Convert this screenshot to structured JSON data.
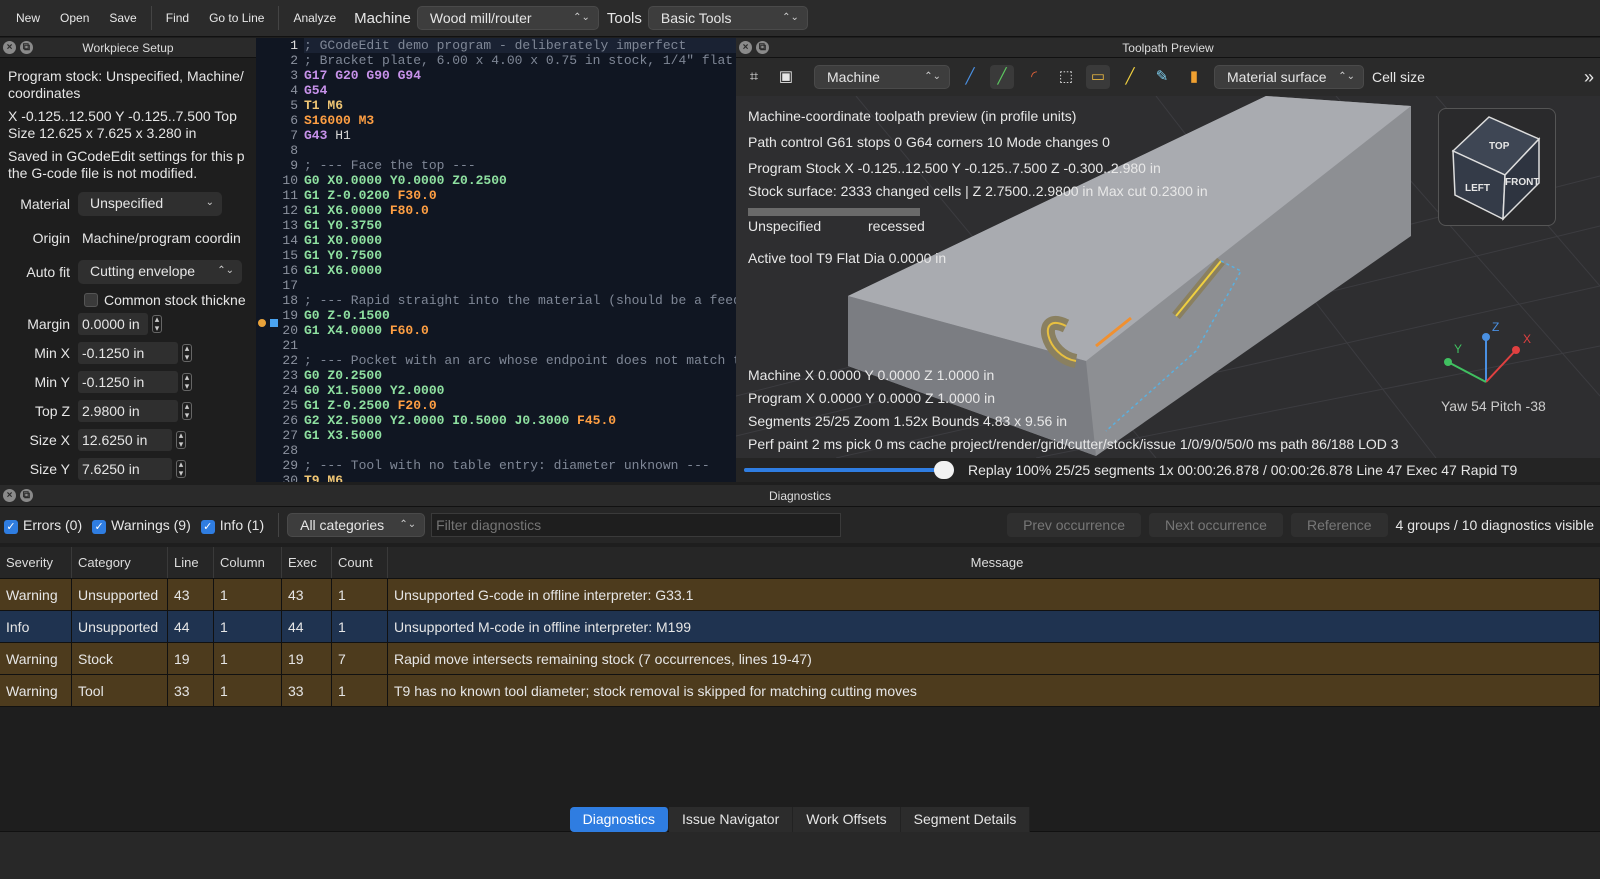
{
  "toolbar": {
    "buttons": [
      "New",
      "Open",
      "Save",
      "Find",
      "Go to Line",
      "Analyze"
    ],
    "machine_label": "Machine",
    "machine_value": "Wood mill/router",
    "tools_label": "Tools",
    "tools_value": "Basic Tools"
  },
  "workpiece": {
    "title": "Workpiece Setup",
    "stock_lines": [
      "Program stock: Unspecified, Machine/",
      "coordinates",
      "X -0.125..12.500  Y -0.125..7.500  Top",
      "Size 12.625 x 7.625 x 3.280 in"
    ],
    "saved_lines": [
      "Saved in GCodeEdit settings for this p",
      "the G-code file is not modified."
    ],
    "material_label": "Material",
    "material_value": "Unspecified",
    "origin_label": "Origin",
    "origin_value": "Machine/program coordin",
    "autofit_label": "Auto fit",
    "autofit_value": "Cutting envelope",
    "common_label": "Common stock thickne",
    "fields": [
      {
        "label": "Margin",
        "value": "0.0000 in"
      },
      {
        "label": "Min X",
        "value": "-0.1250 in"
      },
      {
        "label": "Min Y",
        "value": "-0.1250 in"
      },
      {
        "label": "Top Z",
        "value": "2.9800 in"
      },
      {
        "label": "Size X",
        "value": "12.6250 in"
      },
      {
        "label": "Size Y",
        "value": "7.6250 in"
      }
    ]
  },
  "editor": {
    "lines": [
      [
        [
          "c-com",
          "; GCodeEdit demo program - deliberately imperfect"
        ]
      ],
      [
        [
          "c-com",
          "; Bracket plate, 6.00 x 4.00 x 0.75 in stock, 1/4\" flat"
        ]
      ],
      [
        [
          "c-mode",
          "G17 G20 G90 G94"
        ]
      ],
      [
        [
          "c-mode",
          "G54"
        ]
      ],
      [
        [
          "c-tool",
          "T1 M6"
        ]
      ],
      [
        [
          "c-feed",
          "S16000 M3"
        ]
      ],
      [
        [
          "c-mode",
          "G43"
        ],
        [
          "c-plain",
          " H1"
        ]
      ],
      [
        [
          "c-plain",
          ""
        ]
      ],
      [
        [
          "c-com",
          "; --- Face the top ---"
        ]
      ],
      [
        [
          "c-coord",
          "G0 X0.0000 Y0.0000 Z0.2500"
        ]
      ],
      [
        [
          "c-coord",
          "G1 Z-0.0200 "
        ],
        [
          "c-feed",
          "F30.0"
        ]
      ],
      [
        [
          "c-coord",
          "G1 X6.0000 "
        ],
        [
          "c-feed",
          "F80.0"
        ]
      ],
      [
        [
          "c-coord",
          "G1 Y0.3750"
        ]
      ],
      [
        [
          "c-coord",
          "G1 X0.0000"
        ]
      ],
      [
        [
          "c-coord",
          "G1 Y0.7500"
        ]
      ],
      [
        [
          "c-coord",
          "G1 X6.0000"
        ]
      ],
      [
        [
          "c-plain",
          ""
        ]
      ],
      [
        [
          "c-com",
          "; --- Rapid straight into the material (should be a feed"
        ]
      ],
      [
        [
          "c-coord",
          "G0 Z-0.1500"
        ]
      ],
      [
        [
          "c-coord",
          "G1 X4.0000 "
        ],
        [
          "c-feed",
          "F60.0"
        ]
      ],
      [
        [
          "c-plain",
          ""
        ]
      ],
      [
        [
          "c-com",
          "; --- Pocket with an arc whose endpoint does not match t"
        ]
      ],
      [
        [
          "c-coord",
          "G0 Z0.2500"
        ]
      ],
      [
        [
          "c-coord",
          "G0 X1.5000 Y2.0000"
        ]
      ],
      [
        [
          "c-coord",
          "G1 Z-0.2500 "
        ],
        [
          "c-feed",
          "F20.0"
        ]
      ],
      [
        [
          "c-coord",
          "G2 X2.5000 Y2.0000 I0.5000 J0.3000 "
        ],
        [
          "c-feed",
          "F45.0"
        ]
      ],
      [
        [
          "c-coord",
          "G1 X3.5000"
        ]
      ],
      [
        [
          "c-plain",
          ""
        ]
      ],
      [
        [
          "c-com",
          "; --- Tool with no table entry: diameter unknown ---"
        ]
      ],
      [
        [
          "c-tool",
          "T9 M6"
        ]
      ]
    ]
  },
  "preview": {
    "title": "Toolpath Preview",
    "coord_value": "Machine",
    "surface_value": "Material surface",
    "cellsize_label": "Cell size",
    "info": [
      "Machine-coordinate toolpath preview (in profile units)",
      "Path control  G61 stops 0   G64 corners 10   Mode changes 0",
      "Program Stock  X -0.125..12.500  Y -0.125..7.500  Z -0.300..2.980 in",
      "Stock surface: 2333 changed cells   |   Z 2.7500..2.9800 in   Max cut 0.2300 in"
    ],
    "legend_left": "Unspecified",
    "legend_right": "recessed",
    "active_tool": "Active tool T9   Flat   Dia 0.0000 in",
    "stats": [
      "Machine X 0.0000   Y 0.0000   Z 1.0000 in",
      "Program X 0.0000   Y 0.0000   Z 1.0000 in",
      "Segments 25/25   Zoom 1.52x   Bounds 4.83 x 9.56 in",
      "Perf paint 2 ms   pick 0 ms   cache project/render/grid/cutter/stock/issue 1/0/9/0/50/0 ms   path 86/188 LOD 3"
    ],
    "cube_top": "TOP",
    "cube_left": "LEFT",
    "cube_front": "FRONT",
    "axis_x": "X",
    "axis_y": "Y",
    "axis_z": "Z",
    "yaw_pitch": "Yaw 54   Pitch -38",
    "replay_fraction": 1.0,
    "replay_text": "Replay 100%   25/25 segments   1x   00:00:26.878 / 00:00:26.878   Line 47   Exec 47   Rapid   T9"
  },
  "diagnostics": {
    "title": "Diagnostics",
    "errors": "Errors (0)",
    "warnings": "Warnings (9)",
    "info": "Info (1)",
    "category_value": "All categories",
    "filter_placeholder": "Filter diagnostics",
    "prev": "Prev occurrence",
    "next": "Next occurrence",
    "reference": "Reference",
    "summary": "4 groups / 10 diagnostics visible",
    "columns": [
      "Severity",
      "Category",
      "Line",
      "Column",
      "Exec",
      "Count",
      "Message"
    ],
    "rows": [
      [
        "Warning",
        "Unsupported",
        "43",
        "1",
        "43",
        "1",
        "Unsupported G-code in offline interpreter: G33.1"
      ],
      [
        "Info",
        "Unsupported",
        "44",
        "1",
        "44",
        "1",
        "Unsupported M-code in offline interpreter: M199"
      ],
      [
        "Warning",
        "Stock",
        "19",
        "1",
        "19",
        "7",
        "Rapid move intersects remaining stock (7 occurrences, lines 19-47)"
      ],
      [
        "Warning",
        "Tool",
        "33",
        "1",
        "33",
        "1",
        "T9 has no known tool diameter; stock removal is skipped for matching cutting moves"
      ]
    ],
    "tabs": [
      "Diagnostics",
      "Issue Navigator",
      "Work Offsets",
      "Segment Details"
    ]
  },
  "colors": {
    "accent": "#2f7de1",
    "warning_row": "#4d3b1d",
    "info_row": "#1f3350"
  }
}
